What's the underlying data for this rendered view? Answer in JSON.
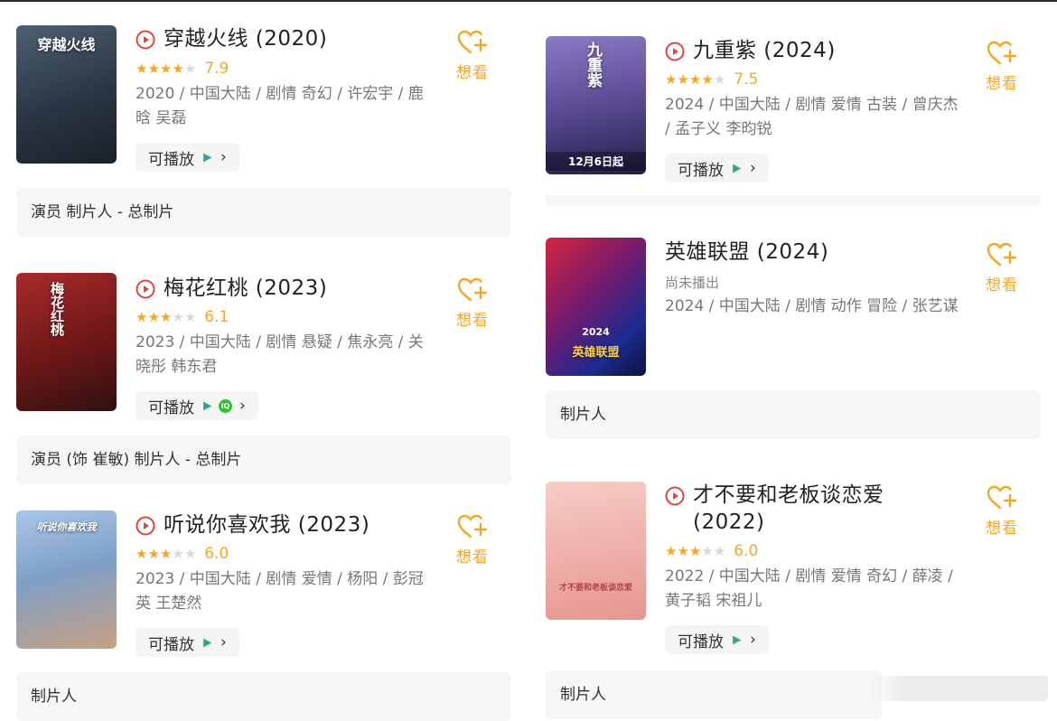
{
  "left_column": [
    {
      "title": "穿越火线 (2020)",
      "show_play_icon": true,
      "stars_filled": 4,
      "score": "7.9",
      "meta": "2020 / 中国大陆 / 剧情 奇幻 / 许宏宇 / 鹿晗 吴磊",
      "playable_label": "可播放",
      "show_iqiyi": false,
      "want_label": "想看",
      "credit": "演员 制片人 - 总制片",
      "poster_text": "穿越火线",
      "poster_colors": [
        "#3b4a5c",
        "#1e2733"
      ]
    },
    {
      "title": "梅花红桃 (2023)",
      "show_play_icon": true,
      "stars_filled": 3,
      "score": "6.1",
      "meta": "2023 / 中国大陆 / 剧情 悬疑 / 焦永亮 / 关晓彤 韩东君",
      "playable_label": "可播放",
      "show_iqiyi": true,
      "iqiyi_text": "iQ",
      "want_label": "想看",
      "credit": "演员 (饰 崔敏) 制片人 - 总制片",
      "poster_text": "梅花红桃",
      "poster_colors": [
        "#8a1f1f",
        "#3a0f10"
      ]
    },
    {
      "title": "听说你喜欢我 (2023)",
      "show_play_icon": true,
      "stars_filled": 3,
      "score": "6.0",
      "meta": "2023 / 中国大陆 / 剧情 爱情 / 杨阳 / 彭冠英 王楚然",
      "playable_label": "可播放",
      "show_iqiyi": false,
      "want_label": "想看",
      "credit": "制片人",
      "poster_text": "听说你喜欢我",
      "poster_colors": [
        "#8fb3d9",
        "#c9a58a"
      ]
    }
  ],
  "right_column": [
    {
      "title": "九重紫 (2024)",
      "show_play_icon": true,
      "stars_filled": 4,
      "score": "7.5",
      "meta": "2024 / 中国大陆 / 剧情 爱情 古装 / 曾庆杰 / 孟子义 李昀锐",
      "playable_label": "可播放",
      "want_label": "想看",
      "poster_text": "九重紫",
      "poster_badge": "12月6日起",
      "poster_colors": [
        "#6b5ba0",
        "#2a2350"
      ]
    },
    {
      "title": "英雄联盟 (2024)",
      "show_play_icon": false,
      "subnote": "尚未播出",
      "meta": "2024 / 中国大陆 / 剧情 动作 冒险 / 张艺谋",
      "want_label": "想看",
      "credit": "制片人",
      "poster_text": "英雄联盟",
      "poster_year": "2024",
      "poster_colors": [
        "#c21f3a",
        "#1c2a8a"
      ]
    },
    {
      "title": "才不要和老板谈恋爱 (2022)",
      "show_play_icon": true,
      "stars_filled": 3,
      "score": "6.0",
      "meta": "2022 / 中国大陆 / 剧情 爱情 奇幻 / 薛凌 / 黄子韬 宋祖儿",
      "playable_label": "可播放",
      "want_label": "想看",
      "credit": "制片人",
      "poster_text": "才不要和老板谈恋爱",
      "poster_colors": [
        "#f0b9b5",
        "#e89a9a"
      ]
    }
  ],
  "colors": {
    "accent": "#f5a623",
    "play_red": "#e0443e",
    "iqiyi_green": "#29c531",
    "card_bg": "#f6f6f6"
  }
}
